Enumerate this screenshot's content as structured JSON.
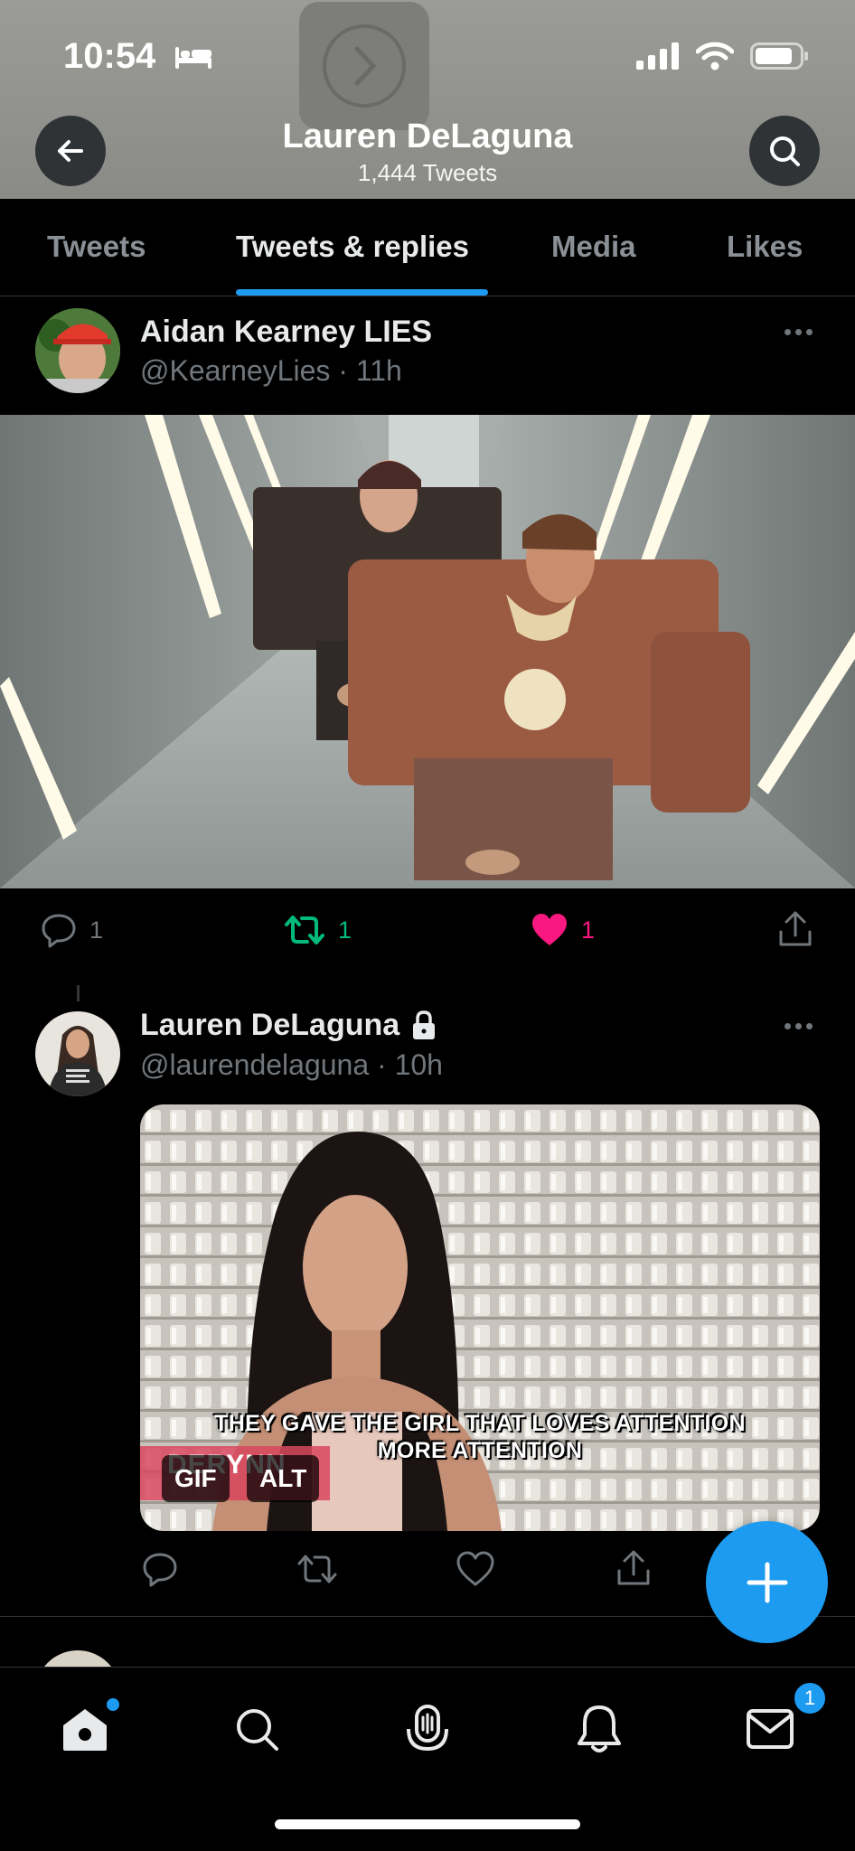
{
  "status_bar": {
    "time": "10:54"
  },
  "header": {
    "name": "Lauren DeLaguna",
    "tweet_count": "1,444 Tweets"
  },
  "tabs": [
    {
      "label": "Tweets"
    },
    {
      "label": "Tweets & replies",
      "active": true
    },
    {
      "label": "Media"
    },
    {
      "label": "Likes"
    }
  ],
  "tweets": [
    {
      "name": "Aidan Kearney LIES",
      "handle": "@KearneyLies · 11h",
      "media": "photo",
      "replies": "1",
      "retweets": "1",
      "likes": "1",
      "liked": true,
      "retweeted": true
    },
    {
      "name": "Lauren DeLaguna",
      "protected": true,
      "handle": "@laurendelaguna · 10h",
      "media": "gif",
      "gif_badge": "GIF",
      "alt_badge": "ALT",
      "caption_line1": "THEY GAVE THE GIRL THAT LOVES ATTENTION",
      "caption_line2": "MORE ATTENTION",
      "lower_third": "DERYNN"
    }
  ],
  "bottom_nav": {
    "items": [
      "home-icon",
      "search-icon",
      "spaces-icon",
      "notifications-icon",
      "messages-icon"
    ],
    "messages_badge": "1"
  },
  "colors": {
    "accent": "#1d9bf0",
    "like": "#f91880",
    "retweet": "#00ba7c",
    "muted": "#71767b"
  }
}
